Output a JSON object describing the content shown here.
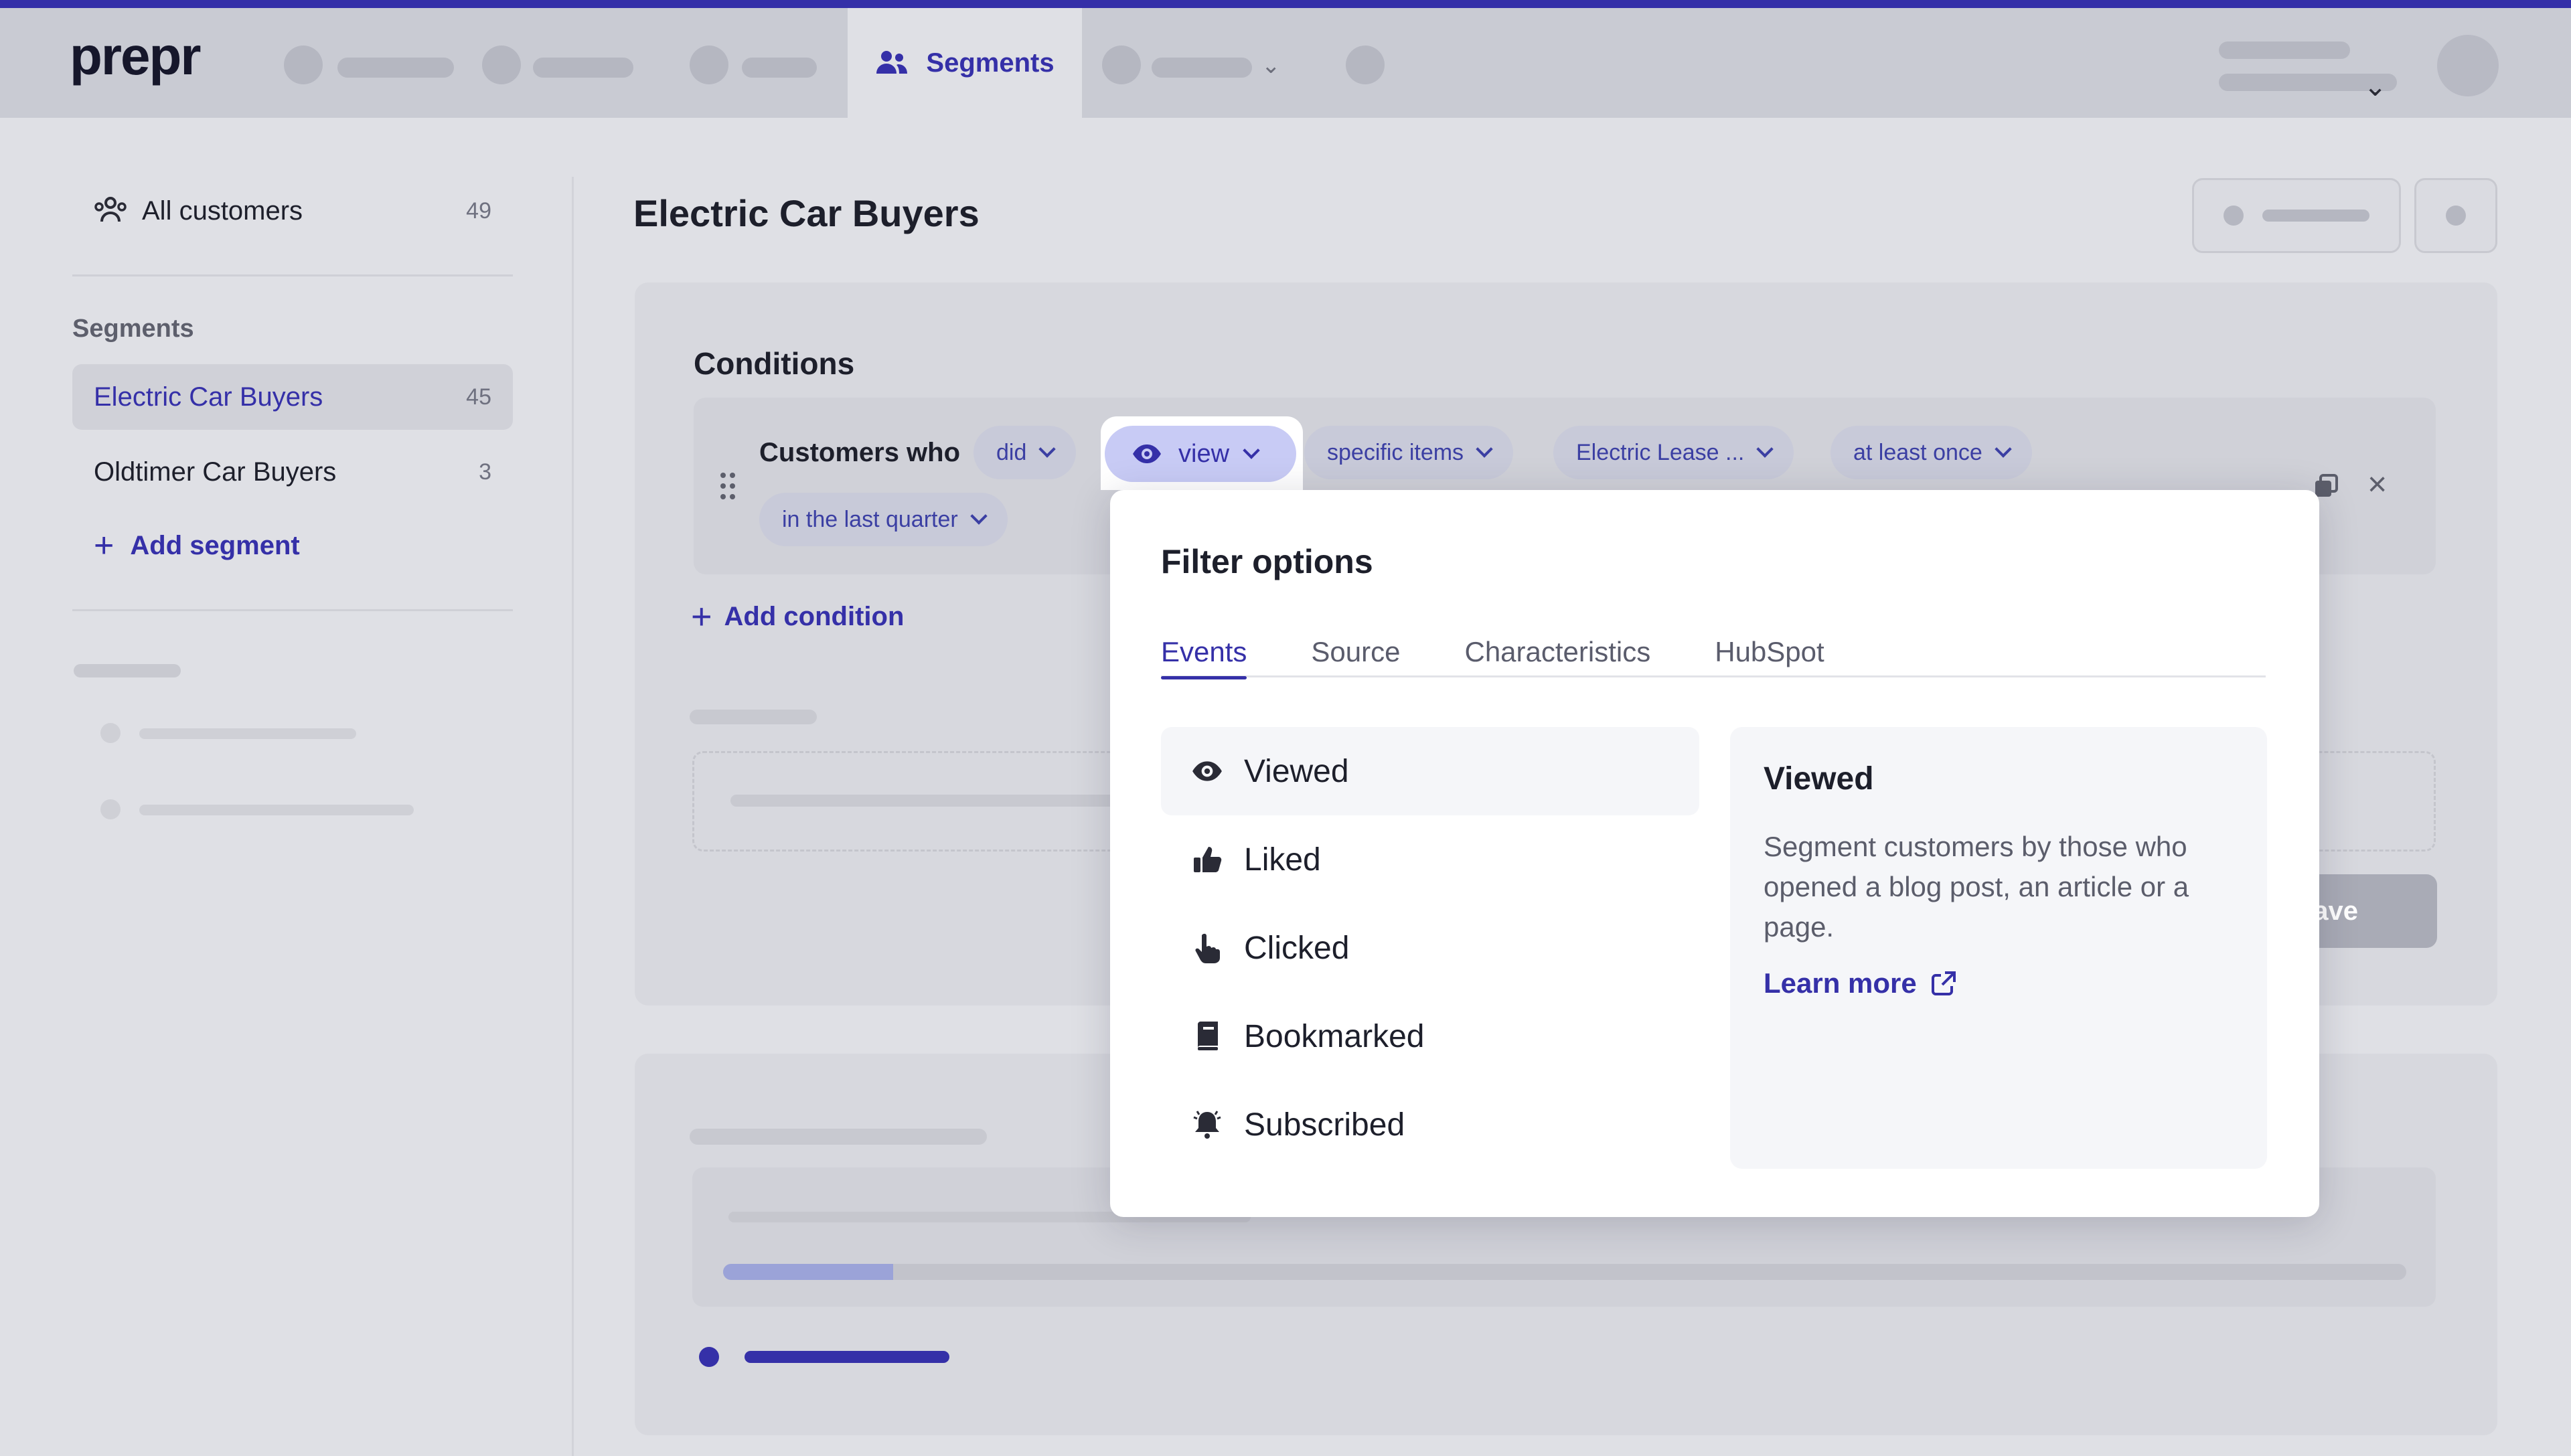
{
  "app": {
    "logo": "prepr"
  },
  "nav": {
    "active_tab": "Segments"
  },
  "sidebar": {
    "all_customers": {
      "label": "All customers",
      "count": "49"
    },
    "segments_heading": "Segments",
    "segments": [
      {
        "label": "Electric Car Buyers",
        "count": "45",
        "active": true
      },
      {
        "label": "Oldtimer Car Buyers",
        "count": "3",
        "active": false
      }
    ],
    "add_segment": "Add segment"
  },
  "main": {
    "title": "Electric Car Buyers",
    "conditions_title": "Conditions",
    "condition": {
      "prefix": "Customers who",
      "chips": [
        "did",
        "view",
        "specific items",
        "Electric Lease ...",
        "at least once",
        "in the last quarter"
      ]
    },
    "add_condition": "Add condition",
    "save_partial": "ave"
  },
  "popover": {
    "title": "Filter options",
    "tabs": [
      "Events",
      "Source",
      "Characteristics",
      "HubSpot"
    ],
    "options": [
      {
        "label": "Viewed",
        "icon": "eye-icon"
      },
      {
        "label": "Liked",
        "icon": "thumbs-up-icon"
      },
      {
        "label": "Clicked",
        "icon": "pointer-icon"
      },
      {
        "label": "Bookmarked",
        "icon": "bookmark-icon"
      },
      {
        "label": "Subscribed",
        "icon": "bell-icon"
      }
    ],
    "detail": {
      "title": "Viewed",
      "text": "Segment customers by those who opened a blog post, an article or a page.",
      "link": "Learn more"
    }
  },
  "colors": {
    "accent": "#3530a8",
    "chip_bg": "#c8cad9",
    "chip_active_bg": "#c8cbf5"
  }
}
